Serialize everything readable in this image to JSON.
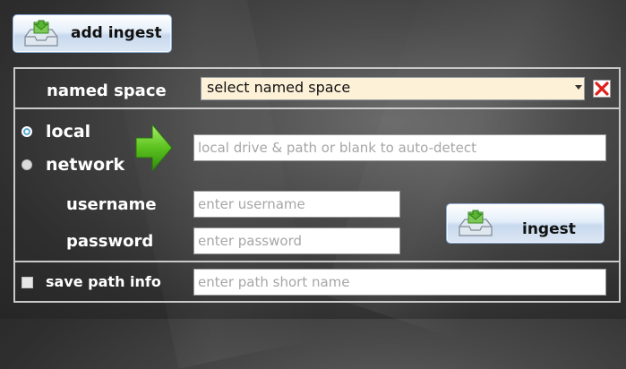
{
  "buttons": {
    "add_ingest": "add ingest",
    "ingest": "ingest"
  },
  "named_space": {
    "label": "named space",
    "selected": "select named space"
  },
  "source": {
    "local_label": "local",
    "network_label": "network",
    "selected": "local",
    "path_placeholder": "local drive & path or blank to auto-detect"
  },
  "credentials": {
    "username_label": "username",
    "username_placeholder": "enter username",
    "password_label": "password",
    "password_placeholder": "enter password"
  },
  "save_path": {
    "label": "save path info",
    "checked": false,
    "placeholder": "enter path short name"
  },
  "colors": {
    "clear_icon": "#e0201a",
    "arrow_icon": "#5bc21e",
    "radio_selected": "#5aa7d6",
    "dropdown_bg": "#fdf1d8"
  },
  "icons": [
    "tray-add-icon",
    "clear-x-icon",
    "dropdown-arrow-icon",
    "arrow-right-icon"
  ]
}
